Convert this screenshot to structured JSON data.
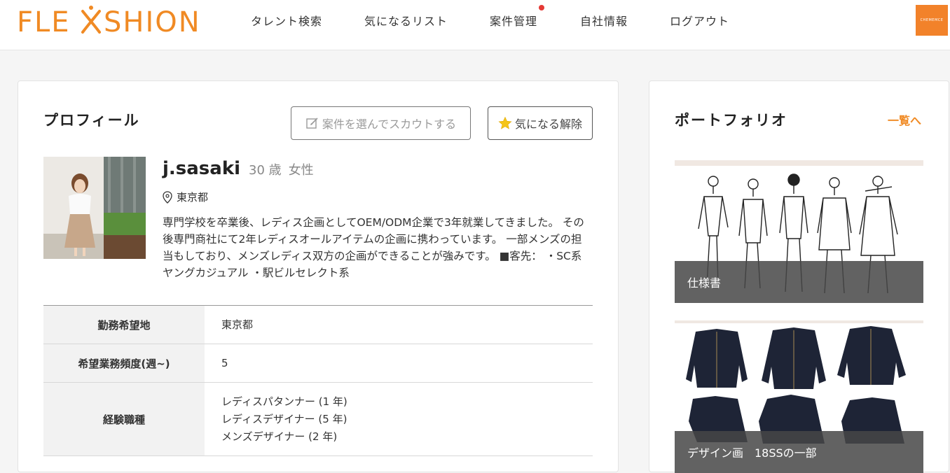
{
  "header": {
    "logo": "FLEXSHION",
    "nav": [
      "タレント検索",
      "気になるリスト",
      "案件管理",
      "自社情報",
      "ログアウト"
    ],
    "avatar_text": "CHEMEMCE"
  },
  "profile": {
    "title": "プロフィール",
    "scout_button": "案件を選んでスカウトする",
    "fav_button": "気になる解除",
    "name": "j.sasaki",
    "age": "30 歳",
    "gender": "女性",
    "location": "東京都",
    "bio": "専門学校を卒業後、レディス企画としてOEM/ODM企業で3年就業してきました。 その後専門商社にて2年レディスオールアイテムの企画に携わっています。 一部メンズの担当もしており、メンズレディス双方の企画ができることが強みです。 ■客先： ・SC系ヤングカジュアル ・駅ビルセレクト系",
    "table": [
      {
        "label": "勤務希望地",
        "values": [
          "東京都"
        ]
      },
      {
        "label": "希望業務頻度(週~)",
        "values": [
          "5"
        ]
      },
      {
        "label": "経験職種",
        "values": [
          "レディスパタンナー (1 年)",
          "レディスデザイナー (5 年)",
          "メンズデザイナー (2 年)"
        ]
      }
    ]
  },
  "portfolio": {
    "title": "ポートフォリオ",
    "more_link": "一覧へ",
    "items": [
      {
        "caption": "仕様書"
      },
      {
        "caption": "デザイン画　18SSの一部"
      }
    ]
  },
  "colors": {
    "brand": "#f08a24",
    "notify": "#e53935",
    "star": "#f5c518"
  }
}
